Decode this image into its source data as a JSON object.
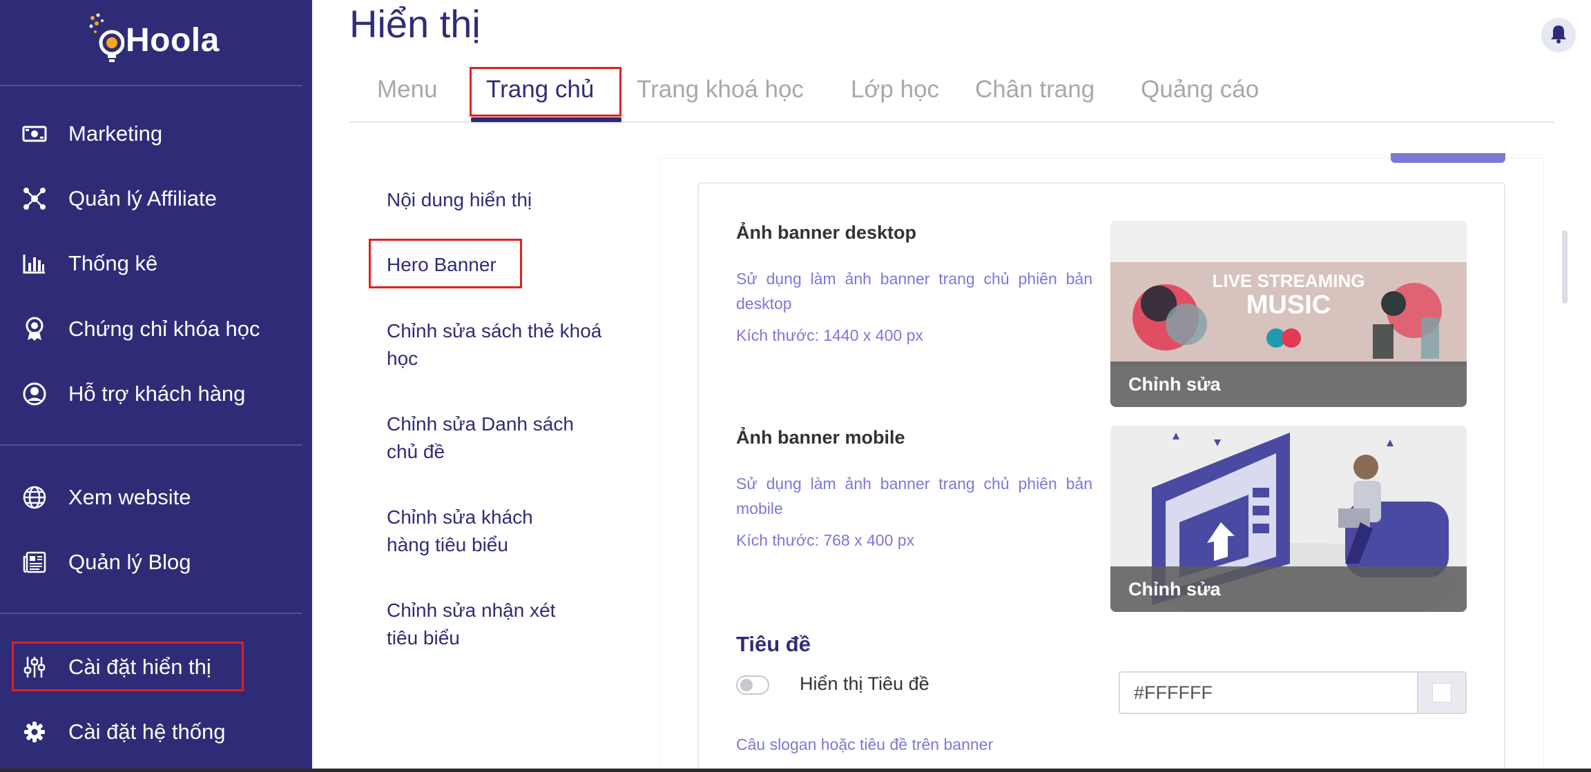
{
  "brand": {
    "name": "Hoola",
    "primary": "#2f2c77",
    "accent": "#7b78d8",
    "highlight": "#e0201f"
  },
  "sidebar": {
    "items": [
      {
        "label": "Marketing",
        "icon": "money-icon"
      },
      {
        "label": "Quản lý Affiliate",
        "icon": "network-icon"
      },
      {
        "label": "Thống kê",
        "icon": "bar-chart-icon"
      },
      {
        "label": "Chứng chỉ khóa học",
        "icon": "award-icon"
      },
      {
        "label": "Hỗ trợ khách hàng",
        "icon": "user-circle-icon"
      },
      {
        "label": "Xem website",
        "icon": "globe-icon"
      },
      {
        "label": "Quản lý Blog",
        "icon": "newspaper-icon"
      },
      {
        "label": "Cài đặt hiển thị",
        "icon": "sliders-icon",
        "active": true
      },
      {
        "label": "Cài đặt hệ thống",
        "icon": "gear-icon"
      }
    ]
  },
  "header": {
    "title": "Hiển thị"
  },
  "tabs": [
    {
      "label": "Menu"
    },
    {
      "label": "Trang chủ",
      "active": true
    },
    {
      "label": "Trang khoá học"
    },
    {
      "label": "Lớp học"
    },
    {
      "label": "Chân trang"
    },
    {
      "label": "Quảng cáo"
    }
  ],
  "subnav": [
    {
      "label": "Nội dung hiển thị"
    },
    {
      "label": "Hero Banner",
      "active": true
    },
    {
      "label": "Chỉnh sửa sách thẻ khoá học"
    },
    {
      "label": "Chỉnh sửa Danh sách chủ đề"
    },
    {
      "label": "Chỉnh sửa khách hàng tiêu biểu"
    },
    {
      "label": "Chỉnh sửa nhận xét tiêu biểu"
    }
  ],
  "desktop_banner": {
    "title": "Ảnh banner desktop",
    "description": "Sử dụng làm ảnh banner trang chủ phiên bản desktop",
    "size": "Kích thước: 1440 x 400 px",
    "image_line1": "LIVE STREAMING",
    "image_line2": "MUSIC",
    "edit_label": "Chỉnh sửa"
  },
  "mobile_banner": {
    "title": "Ảnh banner mobile",
    "description": "Sử dụng làm ảnh banner trang chủ phiên bản mobile",
    "size": "Kích thước: 768 x 400 px",
    "edit_label": "Chỉnh sửa"
  },
  "title_section": {
    "heading": "Tiêu đề",
    "toggle_label": "Hiển thị Tiêu đề",
    "toggle_on": false,
    "color_value": "#FFFFFF",
    "slogan_label": "Câu slogan hoặc tiêu đề trên banner"
  }
}
